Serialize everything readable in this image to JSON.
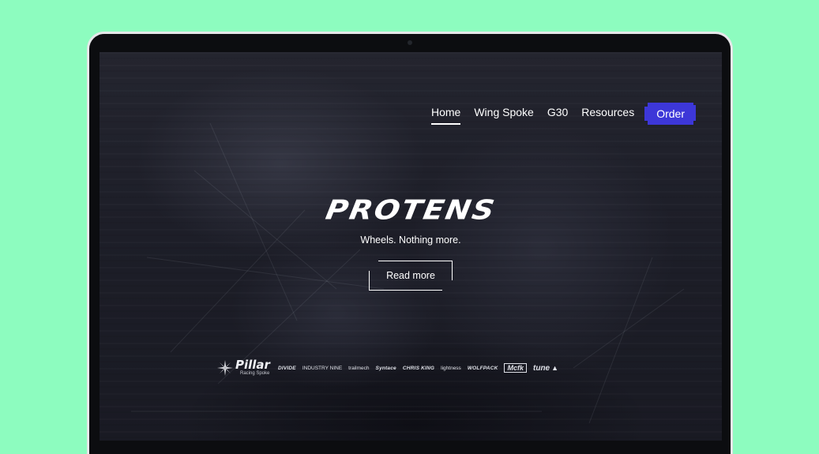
{
  "nav": {
    "items": [
      {
        "label": "Home",
        "active": true
      },
      {
        "label": "Wing Spoke",
        "active": false
      },
      {
        "label": "G30",
        "active": false
      },
      {
        "label": "Resources",
        "active": false
      }
    ],
    "order_label": "Order"
  },
  "hero": {
    "brand": "PROTENS",
    "tagline": "Wheels. Nothing more.",
    "cta_label": "Read more"
  },
  "sponsors": [
    {
      "name": "Pillar",
      "sub": "Racing Spoke"
    },
    {
      "name": "DIVIDE"
    },
    {
      "name": "INDUSTRY NINE"
    },
    {
      "name": "trailmech"
    },
    {
      "name": "Syntace"
    },
    {
      "name": "CHRIS KING"
    },
    {
      "name": "lightness"
    },
    {
      "name": "WOLFPACK"
    },
    {
      "name": "Mcfk"
    },
    {
      "name": "tune"
    }
  ],
  "colors": {
    "background": "#8dfcbf",
    "accent": "#3d37d8",
    "screen": "#1b1c25",
    "text": "#ffffff"
  }
}
